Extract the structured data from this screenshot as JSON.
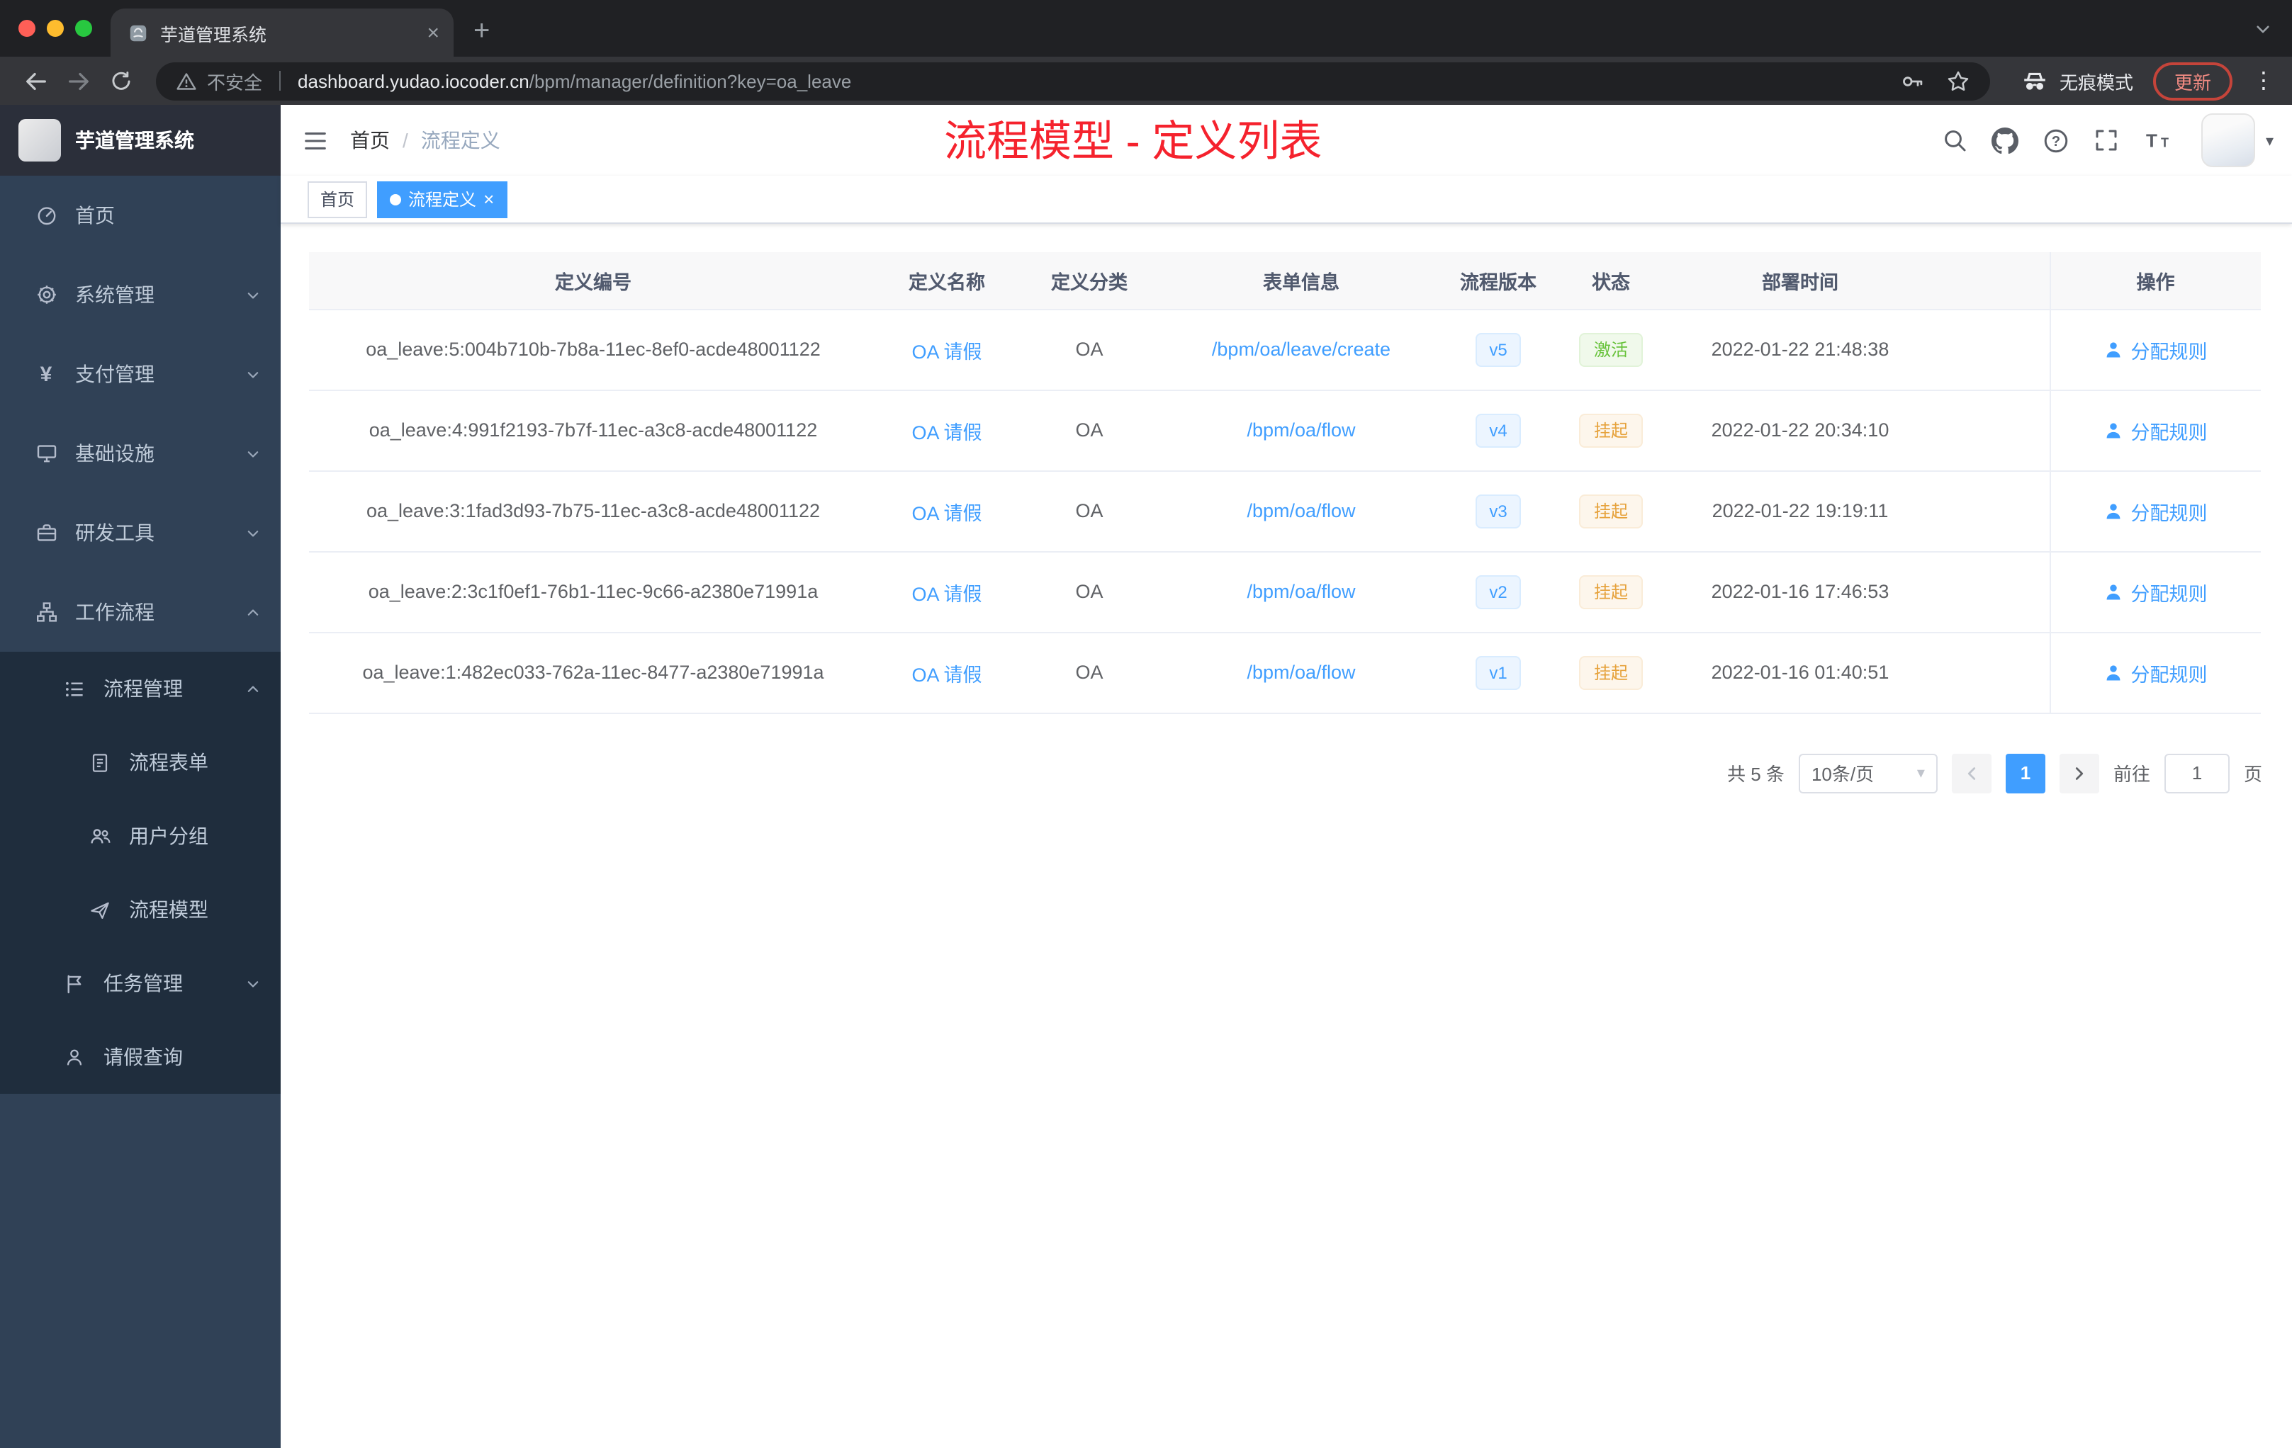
{
  "browser": {
    "tab_title": "芋道管理系统",
    "security_label": "不安全",
    "url_domain": "dashboard.yudao.iocoder.cn",
    "url_path": "/bpm/manager/definition?key=oa_leave",
    "incognito_label": "无痕模式",
    "update_label": "更新"
  },
  "sidebar": {
    "logo_title": "芋道管理系统",
    "items": [
      {
        "label": "首页"
      },
      {
        "label": "系统管理"
      },
      {
        "label": "支付管理"
      },
      {
        "label": "基础设施"
      },
      {
        "label": "研发工具"
      },
      {
        "label": "工作流程"
      },
      {
        "label": "流程管理"
      },
      {
        "label": "流程表单"
      },
      {
        "label": "用户分组"
      },
      {
        "label": "流程模型"
      },
      {
        "label": "任务管理"
      },
      {
        "label": "请假查询"
      }
    ]
  },
  "header": {
    "breadcrumb_home": "首页",
    "breadcrumb_separator": "/",
    "breadcrumb_current": "流程定义",
    "annotation": "流程模型 - 定义列表"
  },
  "tags": {
    "home": "首页",
    "active": "流程定义"
  },
  "table": {
    "columns": [
      "定义编号",
      "定义名称",
      "定义分类",
      "表单信息",
      "流程版本",
      "状态",
      "部署时间",
      "操作"
    ],
    "rows": [
      {
        "id": "oa_leave:5:004b710b-7b8a-11ec-8ef0-acde48001122",
        "name": "OA 请假",
        "category": "OA",
        "form": "/bpm/oa/leave/create",
        "version": "v5",
        "status": "激活",
        "status_type": "success",
        "deploy_time": "2022-01-22 21:48:38",
        "action": "分配规则"
      },
      {
        "id": "oa_leave:4:991f2193-7b7f-11ec-a3c8-acde48001122",
        "name": "OA 请假",
        "category": "OA",
        "form": "/bpm/oa/flow",
        "version": "v4",
        "status": "挂起",
        "status_type": "warning",
        "deploy_time": "2022-01-22 20:34:10",
        "action": "分配规则"
      },
      {
        "id": "oa_leave:3:1fad3d93-7b75-11ec-a3c8-acde48001122",
        "name": "OA 请假",
        "category": "OA",
        "form": "/bpm/oa/flow",
        "version": "v3",
        "status": "挂起",
        "status_type": "warning",
        "deploy_time": "2022-01-22 19:19:11",
        "action": "分配规则"
      },
      {
        "id": "oa_leave:2:3c1f0ef1-76b1-11ec-9c66-a2380e71991a",
        "name": "OA 请假",
        "category": "OA",
        "form": "/bpm/oa/flow",
        "version": "v2",
        "status": "挂起",
        "status_type": "warning",
        "deploy_time": "2022-01-16 17:46:53",
        "action": "分配规则"
      },
      {
        "id": "oa_leave:1:482ec033-762a-11ec-8477-a2380e71991a",
        "name": "OA 请假",
        "category": "OA",
        "form": "/bpm/oa/flow",
        "version": "v1",
        "status": "挂起",
        "status_type": "warning",
        "deploy_time": "2022-01-16 01:40:51",
        "action": "分配规则"
      }
    ]
  },
  "pagination": {
    "total_label": "共 5 条",
    "page_size": "10条/页",
    "current_page": "1",
    "goto_label": "前往",
    "goto_value": "1",
    "page_unit": "页"
  },
  "icons": {
    "close": "×",
    "plus": "+",
    "kebab": "⋮",
    "caret_down": "▾",
    "yen": "¥"
  },
  "colors": {
    "accent": "#409eff",
    "success": "#67c23a",
    "warning": "#e6a23c",
    "annotation_red": "#f5222d",
    "sidebar_bg": "#304156",
    "submenu_bg": "#1f2d3d",
    "chrome_bg": "#202124",
    "toolbar_bg": "#35363a"
  }
}
